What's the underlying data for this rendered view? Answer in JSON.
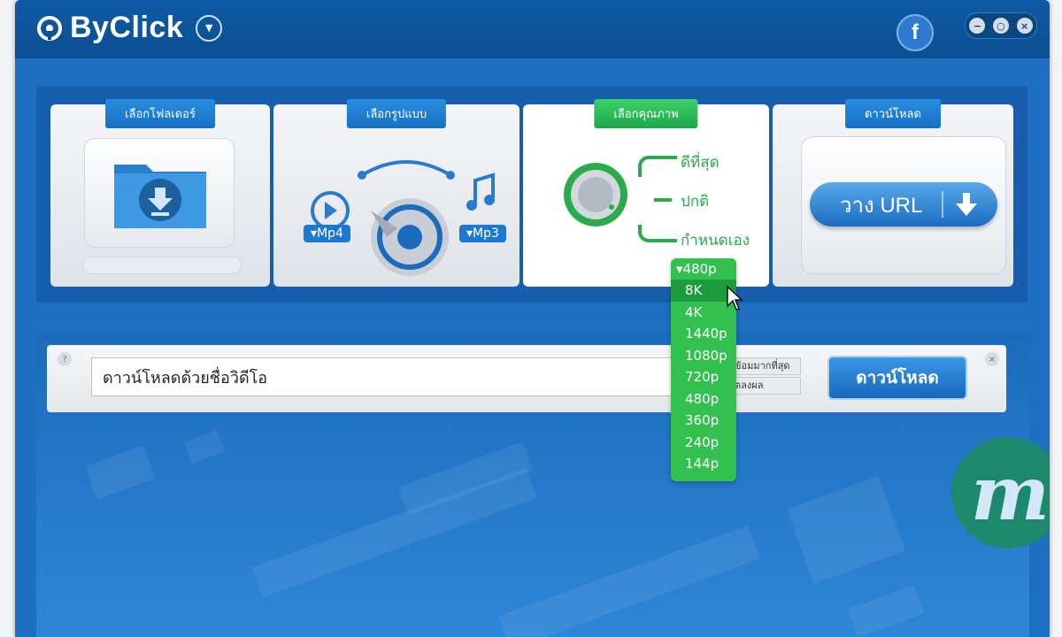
{
  "app": {
    "title": "ByClick"
  },
  "steps": [
    {
      "label": "เลือกโฟลเดอร์"
    },
    {
      "label": "เลือกรูปแบบ",
      "video_format": "Mp4",
      "audio_format": "Mp3"
    },
    {
      "label": "เลือกคุณภาพ",
      "options": [
        "ดีที่สุด",
        "ปกติ",
        "กำหนดเอง"
      ]
    },
    {
      "label": "ดาวน์โหลด",
      "paste_button": "วาง URL"
    }
  ],
  "quality_dropdown": {
    "selected": "480p",
    "items": [
      "8K",
      "4K",
      "1440p",
      "1080p",
      "720p",
      "480p",
      "360p",
      "240p",
      "144p"
    ],
    "hovered": "8K"
  },
  "download_row": {
    "input_value": "ดาวน์โหลดด้วยชื่อวิดีโอ",
    "subtitle_lines": [
      "ข้อมมากที่สุด",
      "ตลงผล"
    ],
    "download_button": "ดาวน์โหลด"
  },
  "colors": {
    "accent_blue": "#1670c5",
    "accent_green": "#2aac4d",
    "titlebar": "#0c4f93"
  }
}
